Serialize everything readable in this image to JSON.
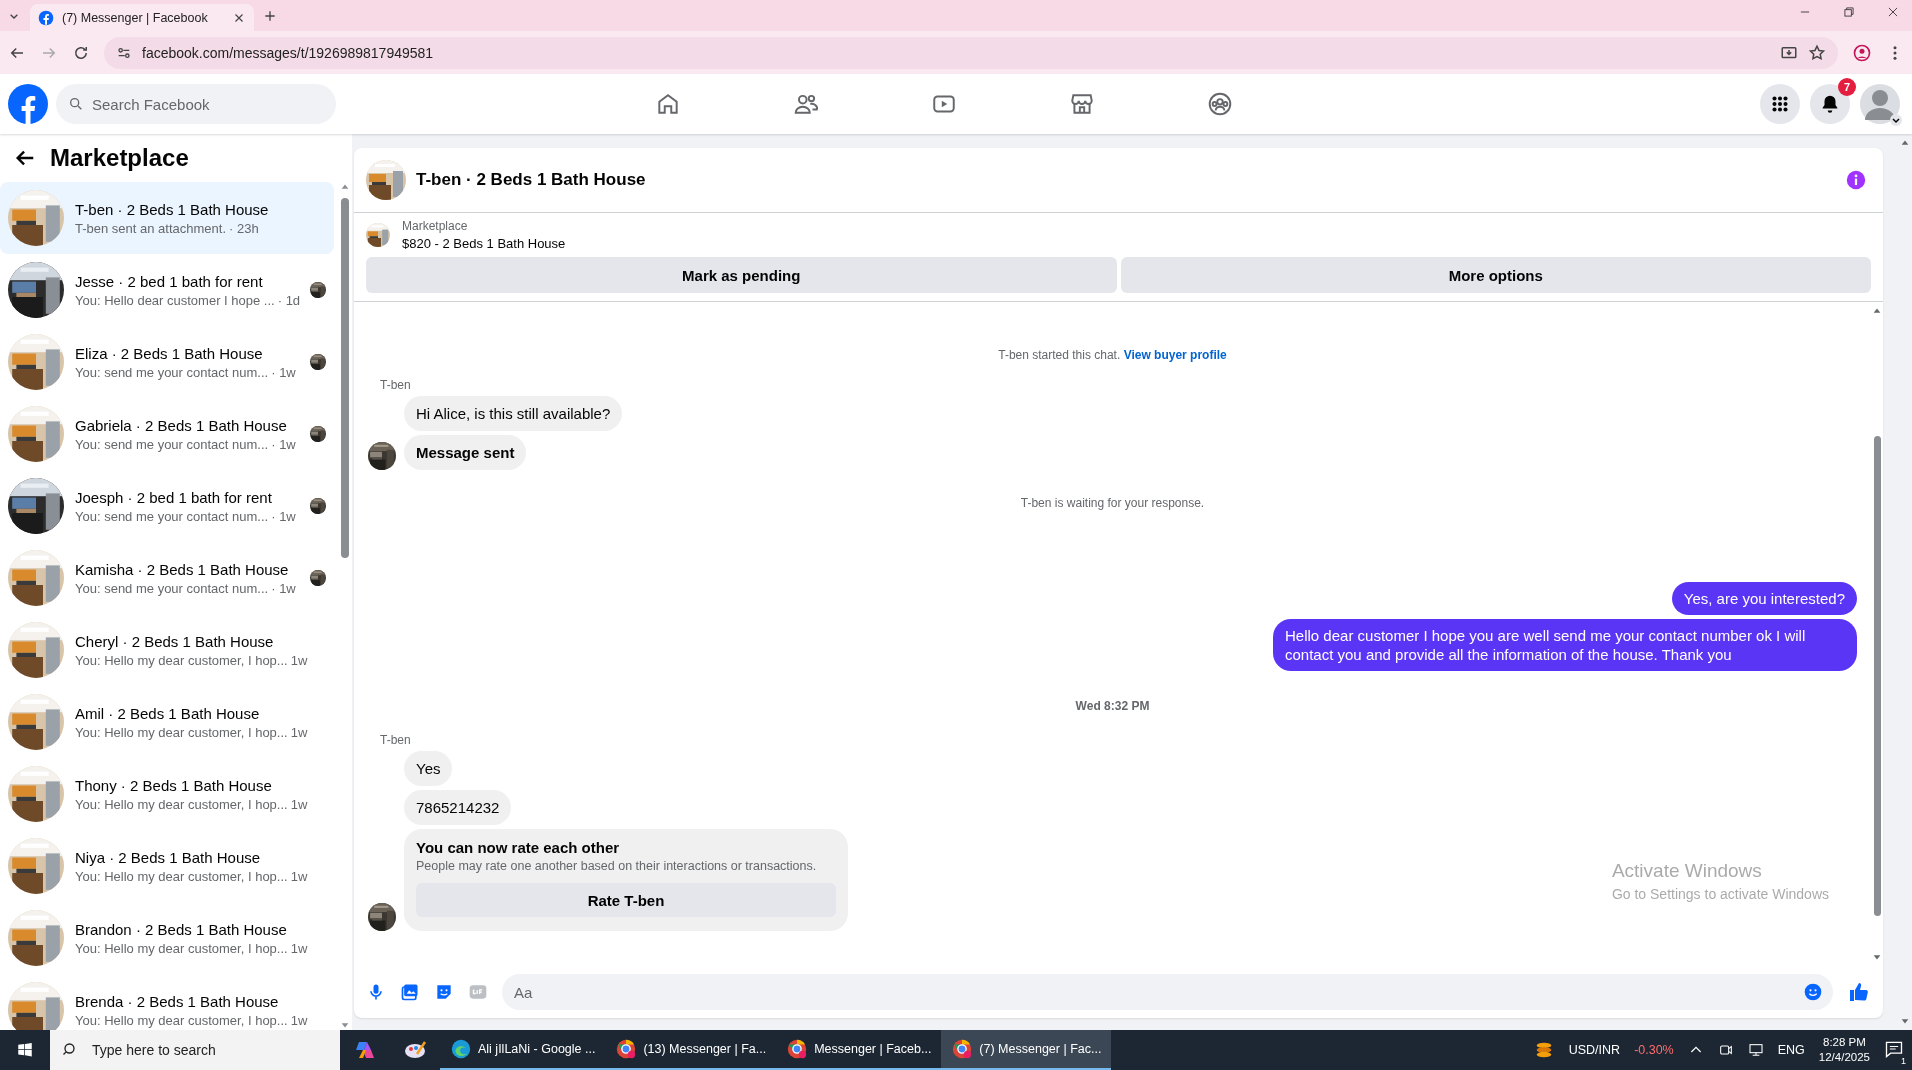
{
  "browser": {
    "tab_title": "(7) Messenger | Facebook",
    "url": "facebook.com/messages/t/1926989817949581"
  },
  "topbar": {
    "search_placeholder": "Search Facebook",
    "notification_count": "7"
  },
  "sidebar": {
    "title": "Marketplace",
    "conversations": [
      {
        "title": "T-ben · 2 Beds 1 Bath House",
        "preview": "T-ben sent an attachment.",
        "time": "· 23h",
        "selected": true,
        "seen": false
      },
      {
        "title": "Jesse · 2 bed 1 bath for rent",
        "preview": "You: Hello dear customer I hope ...",
        "time": "· 1d",
        "selected": false,
        "seen": true
      },
      {
        "title": "Eliza · 2 Beds 1 Bath House",
        "preview": "You: send me your contact num...",
        "time": "· 1w",
        "selected": false,
        "seen": true
      },
      {
        "title": "Gabriela · 2 Beds 1 Bath House",
        "preview": "You: send me your contact num...",
        "time": "· 1w",
        "selected": false,
        "seen": true
      },
      {
        "title": "Joesph · 2 bed 1 bath for rent",
        "preview": "You: send me your contact num...",
        "time": "· 1w",
        "selected": false,
        "seen": true
      },
      {
        "title": "Kamisha · 2 Beds 1 Bath House",
        "preview": "You: send me your contact num...",
        "time": "· 1w",
        "selected": false,
        "seen": true
      },
      {
        "title": "Cheryl · 2 Beds 1 Bath House",
        "preview": "You: Hello my dear customer, I hop...",
        "time": "1w",
        "selected": false,
        "seen": false
      },
      {
        "title": "Amil · 2 Beds 1 Bath House",
        "preview": "You: Hello my dear customer, I hop...",
        "time": "1w",
        "selected": false,
        "seen": false
      },
      {
        "title": "Thony · 2 Beds 1 Bath House",
        "preview": "You: Hello my dear customer, I hop...",
        "time": "1w",
        "selected": false,
        "seen": false
      },
      {
        "title": "Niya · 2 Beds 1 Bath House",
        "preview": "You: Hello my dear customer, I hop...",
        "time": "1w",
        "selected": false,
        "seen": false
      },
      {
        "title": "Brandon · 2 Beds 1 Bath House",
        "preview": "You: Hello my dear customer, I hop...",
        "time": "1w",
        "selected": false,
        "seen": false
      },
      {
        "title": "Brenda · 2 Beds 1 Bath House",
        "preview": "You: Hello my dear customer, I hop...",
        "time": "1w",
        "selected": false,
        "seen": false
      }
    ]
  },
  "chat": {
    "title": "T-ben · 2 Beds 1 Bath House",
    "listing_label": "Marketplace",
    "listing": "$820 - 2 Beds 1 Bath House",
    "actions": [
      "Mark as pending",
      "More options"
    ],
    "messages": [
      {
        "kind": "notice",
        "text": "T-ben started this chat.",
        "link": "View buyer profile"
      },
      {
        "kind": "incoming",
        "sender": "T-ben",
        "bubbles": [
          {
            "kind": "text",
            "text": "Hi Alice, is this still available?"
          },
          {
            "kind": "status",
            "text": "Message sent"
          }
        ]
      },
      {
        "kind": "notice",
        "text": "T-ben is waiting for your response."
      },
      {
        "kind": "outgoing",
        "bubbles": [
          {
            "kind": "text",
            "text": "Yes, are you interested?"
          },
          {
            "kind": "text",
            "text": "Hello dear customer I hope you are well send me your contact number ok I will contact you and provide all the information of the house. Thank you"
          }
        ]
      },
      {
        "kind": "timestamp",
        "text": "Wed 8:32 PM"
      },
      {
        "kind": "incoming",
        "sender": "T-ben",
        "bubbles": [
          {
            "kind": "text",
            "text": "Yes"
          },
          {
            "kind": "text",
            "text": "7865214232"
          },
          {
            "kind": "card",
            "title": "You can now rate each other",
            "text": "People may rate one another based on their interactions or transactions.",
            "button": "Rate T-ben"
          }
        ]
      }
    ],
    "composer_placeholder": "Aa"
  },
  "activation_notice": {
    "title": "Activate Windows",
    "text": "Go to Settings to activate Windows"
  },
  "taskbar": {
    "search_placeholder": "Type here to search",
    "apps": [
      {
        "label": "Ali jIlLaNi - Google ...",
        "kind": "edge",
        "selected": false
      },
      {
        "label": "(13) Messenger | Fa...",
        "kind": "chrome",
        "selected": false
      },
      {
        "label": "Messenger | Faceb...",
        "kind": "chrome",
        "selected": false
      },
      {
        "label": "(7) Messenger | Fac...",
        "kind": "chrome",
        "selected": true
      }
    ],
    "ticker": "USD/INR",
    "change": "-0.30%",
    "language": "ENG",
    "time": "8:28 PM",
    "date": "12/4/2025",
    "notifications": "1"
  }
}
